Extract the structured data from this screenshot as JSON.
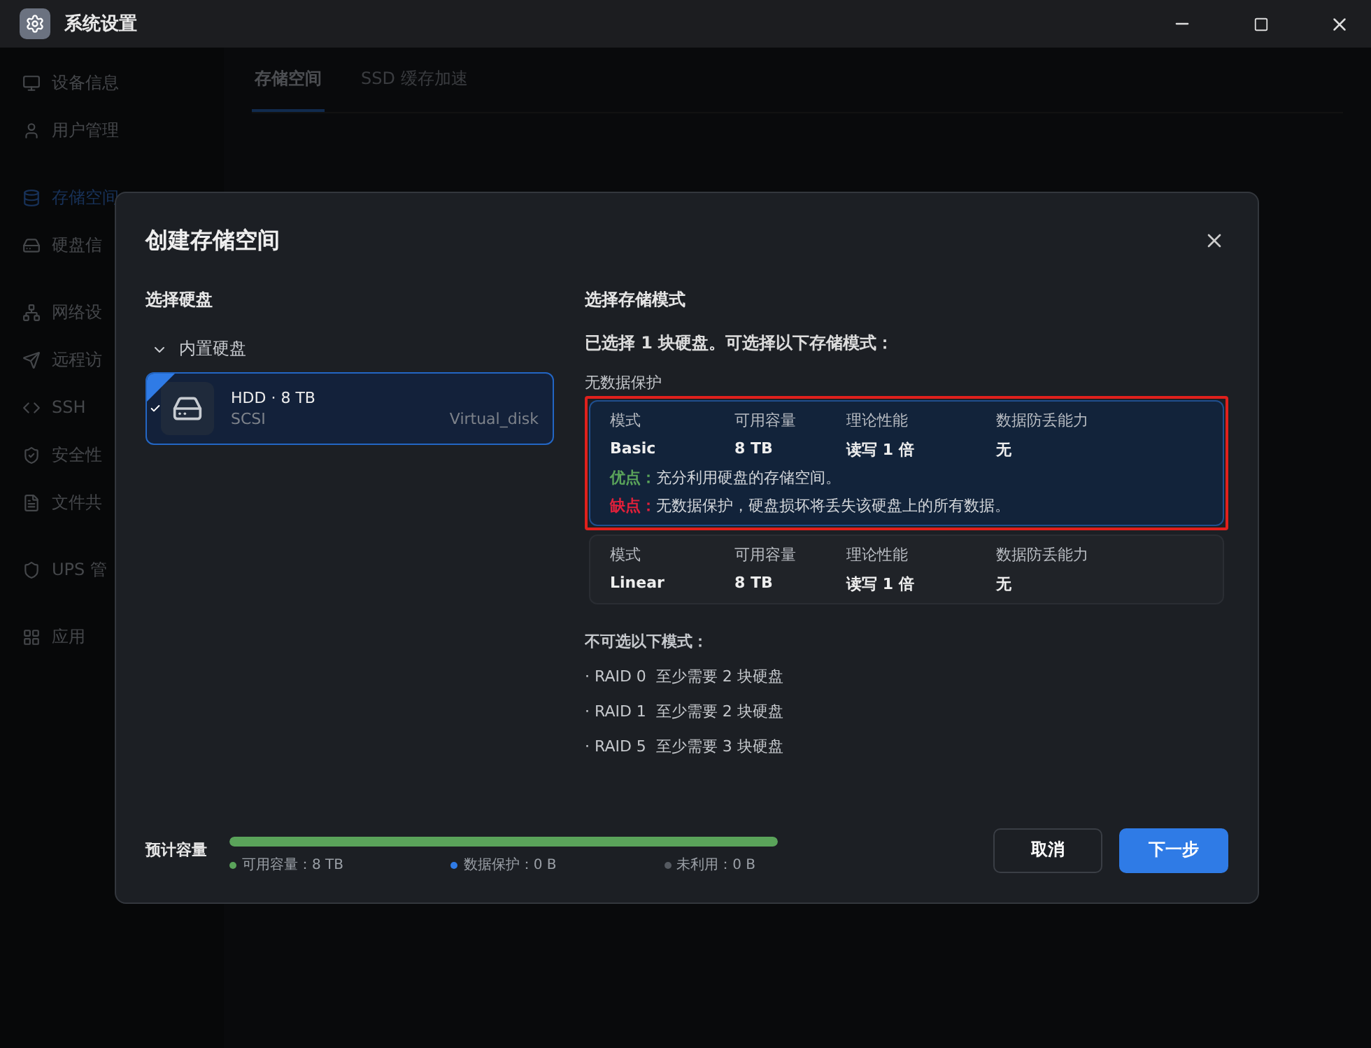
{
  "window": {
    "title": "系统设置"
  },
  "sidebar": {
    "items": [
      {
        "label": "设备信息",
        "selected": false
      },
      {
        "label": "用户管理",
        "selected": false
      },
      {
        "label": "存储空间",
        "selected": true
      },
      {
        "label": "硬盘信",
        "selected": false
      },
      {
        "label": "网络设",
        "selected": false
      },
      {
        "label": "远程访",
        "selected": false
      },
      {
        "label": "SSH",
        "selected": false
      },
      {
        "label": "安全性",
        "selected": false
      },
      {
        "label": "文件共",
        "selected": false
      },
      {
        "label": "UPS 管",
        "selected": false
      },
      {
        "label": "应用",
        "selected": false
      }
    ]
  },
  "tabs": [
    {
      "label": "存储空间",
      "selected": true
    },
    {
      "label": "SSD 缓存加速",
      "selected": false
    }
  ],
  "dialog": {
    "title": "创建存储空间",
    "disk_section": {
      "title": "选择硬盘",
      "group": {
        "label": "内置硬盘",
        "expanded": true
      },
      "disks": [
        {
          "name": "HDD · 8 TB",
          "bus": "SCSI",
          "model": "Virtual_disk",
          "selected": true
        }
      ]
    },
    "mode_section": {
      "title": "选择存储模式",
      "summary": "已选择 1 块硬盘。可选择以下存储模式：",
      "group_label": "无数据保护",
      "modes": [
        {
          "columns": [
            "模式",
            "可用容量",
            "理论性能",
            "数据防丢能力"
          ],
          "values": [
            "Basic",
            "8 TB",
            "读写 1 倍",
            "无"
          ],
          "selected": true,
          "highlighted": true,
          "pros_label": "优点：",
          "pros": "充分利用硬盘的存储空间。",
          "cons_label": "缺点：",
          "cons": "无数据保护，硬盘损坏将丢失该硬盘上的所有数据。"
        },
        {
          "columns": [
            "模式",
            "可用容量",
            "理论性能",
            "数据防丢能力"
          ],
          "values": [
            "Linear",
            "8 TB",
            "读写 1 倍",
            "无"
          ],
          "selected": false,
          "highlighted": false
        }
      ],
      "unavailable_title": "不可选以下模式：",
      "unavailable": [
        {
          "mode": "· RAID 0",
          "reason": "至少需要 2 块硬盘"
        },
        {
          "mode": "· RAID 1",
          "reason": "至少需要 2 块硬盘"
        },
        {
          "mode": "· RAID 5",
          "reason": "至少需要 3 块硬盘"
        }
      ]
    },
    "capacity": {
      "label": "预计容量",
      "level": 1,
      "legend": [
        {
          "label": "可用容量：8 TB",
          "color": "#5aa35a"
        },
        {
          "label": "数据保护：0 B",
          "color": "#2f7be6"
        },
        {
          "label": "未利用：0 B",
          "color": "#555a61"
        }
      ]
    },
    "buttons": [
      {
        "label": "取消",
        "kind": "secondary"
      },
      {
        "label": "下一步",
        "kind": "primary"
      }
    ]
  }
}
